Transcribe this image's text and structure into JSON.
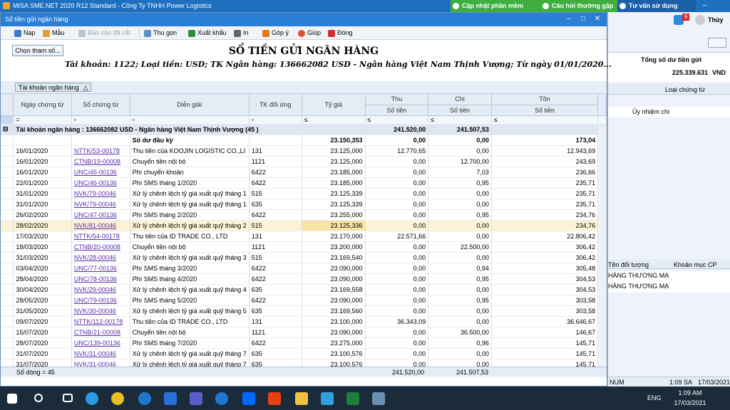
{
  "app": {
    "title": "MISA SME.NET 2020 R12 Standard - Công Ty TNHH Power Logistics",
    "update": "Cập nhật phần mềm",
    "faq": "Câu hỏi thường gặp",
    "support": "Tư vấn sử dụng",
    "user": "Thùy",
    "badge": "9"
  },
  "window": {
    "title": "Sổ tiền gửi ngân hàng"
  },
  "toolbar": {
    "nap": "Nạp",
    "mau": "Mẫu",
    "bcdc": "Báo cáo đã cắt",
    "thugon": "Thu gọn",
    "xuatkhau": "Xuất khẩu",
    "in": "In",
    "gopy": "Góp ý",
    "giup": "Giúp",
    "dong": "Đóng"
  },
  "report": {
    "chon": "Chọn tham số...",
    "title": "SỔ TIỀN GỬI NGÂN HÀNG",
    "subtitle": "Tài khoản: 1122; Loại tiền: USD; TK Ngân hàng: 136662082 USD - Ngân hàng Việt Nam Thịnh Vượng; Từ ngày 01/01/2020...",
    "group_chip": "Tài khoản ngân hàng"
  },
  "cols": {
    "ngay": "Ngày chứng từ",
    "so": "Số chứng từ",
    "dien": "Diễn giải",
    "tk": "TK đối ứng",
    "tygia": "Tỷ giá",
    "thu": "Thu",
    "chi": "Chi",
    "ton": "Tồn",
    "sotien": "Số tiền"
  },
  "group_row": {
    "label": "Tài khoản ngân hàng : 136662082 USD - Ngân hàng Việt Nam Thịnh Vượng (45 )",
    "thu": "241.520,00",
    "chi": "241.507,53"
  },
  "opening": {
    "label": "Số dư đầu kỳ",
    "tygia": "23.150,353",
    "thu": "0,00",
    "chi": "0,00",
    "ton": "173,04"
  },
  "rows": [
    [
      "16/01/2020",
      "NTTK/53-00178",
      "Thu tiền của KOOJIN LOGISTIC CO.,LI",
      "131",
      "23.125,000",
      "12.770,65",
      "0,00",
      "12.943,69"
    ],
    [
      "16/01/2020",
      "CTNB/19-00008",
      "Chuyển tiền nội bộ",
      "1121",
      "23.125,000",
      "0,00",
      "12.700,00",
      "243,69"
    ],
    [
      "16/01/2020",
      "UNC/45-00136",
      "Phí chuyển khoản",
      "6422",
      "23.185,000",
      "0,00",
      "7,03",
      "236,66"
    ],
    [
      "22/01/2020",
      "UNC/46-00136",
      "Phí SMS tháng 1/2020",
      "6422",
      "23.185,000",
      "0,00",
      "0,95",
      "235,71"
    ],
    [
      "31/01/2020",
      "NVK/79-00046",
      "Xử lý chênh lệch tỷ giá xuất quỹ tháng 1",
      "515",
      "23.125,339",
      "0,00",
      "0,00",
      "235,71"
    ],
    [
      "31/01/2020",
      "NVK/79-00046",
      "Xử lý chênh lệch tỷ giá xuất quỹ tháng 1",
      "635",
      "23.125,339",
      "0,00",
      "0,00",
      "235,71"
    ],
    [
      "26/02/2020",
      "UNC/47-00136",
      "Phí SMS tháng 2/2020",
      "6422",
      "23.255,000",
      "0,00",
      "0,95",
      "234,76"
    ],
    [
      "28/02/2020",
      "NVK/81-00046",
      "Xử lý chênh lệch tỷ giá xuất quỹ tháng 2",
      "515",
      "23.125,336",
      "0,00",
      "0,00",
      "234,76"
    ],
    [
      "17/03/2020",
      "NTTK/54-00178",
      "Thu tiền của ID TRADE CO., LTD",
      "131",
      "23.170,000",
      "22.571,66",
      "0,00",
      "22.806,42"
    ],
    [
      "18/03/2020",
      "CTNB/20-00008",
      "Chuyển tiền nội bộ",
      "1121",
      "23.200,000",
      "0,00",
      "22.500,00",
      "306,42"
    ],
    [
      "31/03/2020",
      "NVK/28-00046",
      "Xử lý chênh lệch tỷ giá xuất quỹ tháng 3",
      "515",
      "23.169,540",
      "0,00",
      "0,00",
      "306,42"
    ],
    [
      "03/04/2020",
      "UNC/77-00136",
      "Phí SMS tháng 3/2020",
      "6422",
      "23.090,000",
      "0,00",
      "0,94",
      "305,48"
    ],
    [
      "28/04/2020",
      "UNC/78-00136",
      "Phí SMS tháng 4/2020",
      "6422",
      "23.090,000",
      "0,00",
      "0,95",
      "304,53"
    ],
    [
      "30/04/2020",
      "NVK/29-00046",
      "Xử lý chênh lệch tỷ giá xuất quỹ tháng 4",
      "635",
      "23.169,558",
      "0,00",
      "0,00",
      "304,53"
    ],
    [
      "28/05/2020",
      "UNC/79-00136",
      "Phí SMS tháng 5/2020",
      "6422",
      "23.090,000",
      "0,00",
      "0,95",
      "303,58"
    ],
    [
      "31/05/2020",
      "NVK/30-00046",
      "Xử lý chênh lệch tỷ giá xuất quỹ tháng 5",
      "635",
      "23.169,560",
      "0,00",
      "0,00",
      "303,58"
    ],
    [
      "09/07/2020",
      "NTTK/112-00178",
      "Thu tiền của ID TRADE CO., LTD",
      "131",
      "23.100,000",
      "36.343,09",
      "0,00",
      "36.646,67"
    ],
    [
      "15/07/2020",
      "CTNB/21-00008",
      "Chuyển tiền nội bộ",
      "1121",
      "23.090,000",
      "0,00",
      "36.500,00",
      "146,67"
    ],
    [
      "28/07/2020",
      "UNC/139-00136",
      "Phí SMS tháng 7/2020",
      "6422",
      "23.275,000",
      "0,00",
      "0,96",
      "145,71"
    ],
    [
      "31/07/2020",
      "NVK/31-00046",
      "Xử lý chênh lệch tỷ giá xuất quỹ tháng 7",
      "635",
      "23.100,576",
      "0,00",
      "0,00",
      "145,71"
    ],
    [
      "31/07/2020",
      "NVK/31-00046",
      "Xử lý chênh lệch tỷ giá xuất quỹ tháng 7",
      "635",
      "23.100,576",
      "0,00",
      "0,00",
      "145,71"
    ]
  ],
  "footer": {
    "count": "Số dòng = 45",
    "thu": "241.520,00",
    "chi": "241.507,53"
  },
  "right": {
    "total_label": "Tổng số dư tiền gửi",
    "total": "225.339.631",
    "cur": "VND",
    "col1": "Loại chứng từ",
    "val1": "Ủy nhiệm chi",
    "col2": "Tên đối tượng",
    "col3": "Khoản mục CP",
    "obj1": "HÀNG THƯƠNG MẠ",
    "obj2": "HÀNG THƯƠNG MẠ",
    "num": "NUM",
    "time": "1:09 SA",
    "date": "17/03/2021"
  },
  "taskbar": {
    "time": "1:09 AM",
    "date": "17/03/2021",
    "lang": "ENG"
  }
}
